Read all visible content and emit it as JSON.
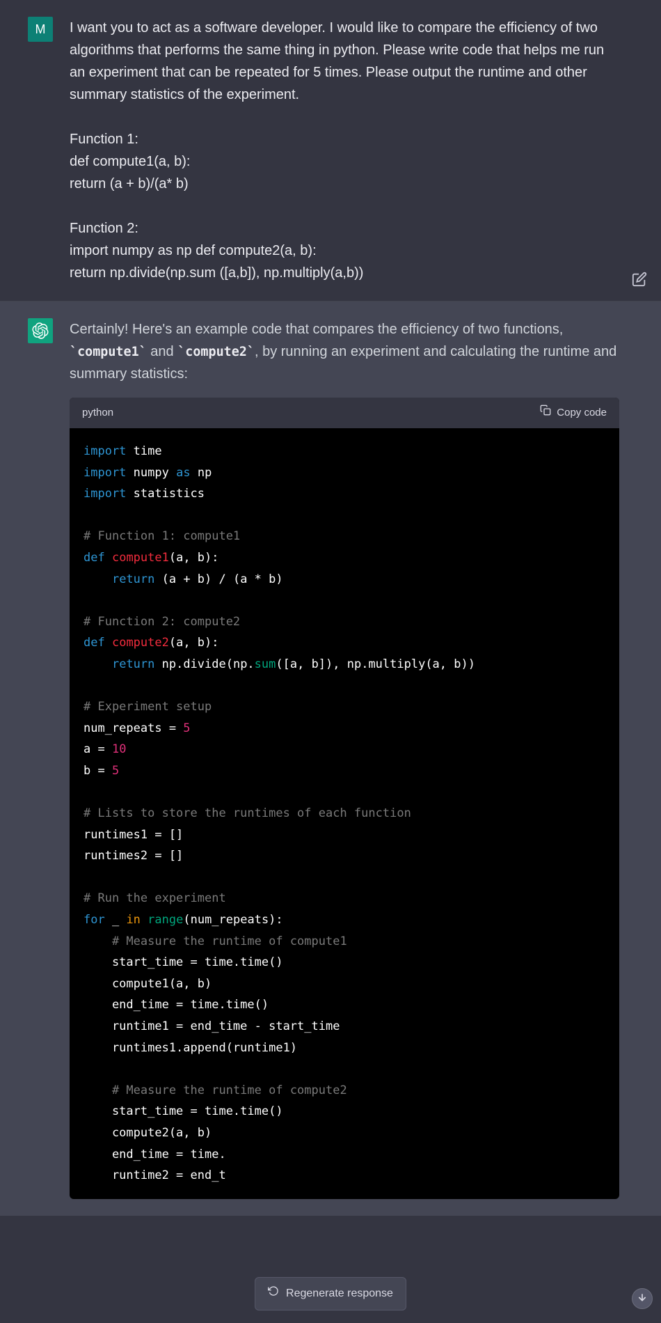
{
  "user": {
    "avatar_letter": "M",
    "message": "I want you to act as a software developer. I would like to compare the efficiency of two algorithms that performs the same thing in python. Please write code that helps me run an experiment that can be repeated for 5 times. Please output the runtime and other summary statistics of the experiment.\n\nFunction 1:\ndef compute1(a, b):\nreturn (a + b)/(a* b)\n\nFunction 2:\nimport numpy as np def compute2(a, b):\nreturn np.divide(np.sum ([a,b]), np.multiply(a,b))"
  },
  "assistant": {
    "intro_pre": "Certainly! Here's an example code that compares the efficiency of two functions, ",
    "code1": "`compute1`",
    "intro_mid": " and ",
    "code2": "`compute2`",
    "intro_post": ", by running an experiment and calculating the runtime and summary statistics:"
  },
  "codeblock": {
    "language": "python",
    "copy_label": "Copy code",
    "lines": [
      [
        [
          "kw",
          "import"
        ],
        [
          "pl",
          " "
        ],
        [
          "mod",
          "time"
        ]
      ],
      [
        [
          "kw",
          "import"
        ],
        [
          "pl",
          " "
        ],
        [
          "mod",
          "numpy"
        ],
        [
          "pl",
          " "
        ],
        [
          "kw",
          "as"
        ],
        [
          "pl",
          " "
        ],
        [
          "mod",
          "np"
        ]
      ],
      [
        [
          "kw",
          "import"
        ],
        [
          "pl",
          " "
        ],
        [
          "mod",
          "statistics"
        ]
      ],
      [],
      [
        [
          "cmt",
          "# Function 1: compute1"
        ]
      ],
      [
        [
          "def",
          "def"
        ],
        [
          "pl",
          " "
        ],
        [
          "fn",
          "compute1"
        ],
        [
          "pl",
          "(a, b):"
        ]
      ],
      [
        [
          "pl",
          "    "
        ],
        [
          "ret",
          "return"
        ],
        [
          "pl",
          " (a + b) / (a * b)"
        ]
      ],
      [],
      [
        [
          "cmt",
          "# Function 2: compute2"
        ]
      ],
      [
        [
          "def",
          "def"
        ],
        [
          "pl",
          " "
        ],
        [
          "fn",
          "compute2"
        ],
        [
          "pl",
          "(a, b):"
        ]
      ],
      [
        [
          "pl",
          "    "
        ],
        [
          "ret",
          "return"
        ],
        [
          "pl",
          " np.divide(np."
        ],
        [
          "call",
          "sum"
        ],
        [
          "pl",
          "([a, b]), np.multiply(a, b))"
        ]
      ],
      [],
      [
        [
          "cmt",
          "# Experiment setup"
        ]
      ],
      [
        [
          "pl",
          "num_repeats = "
        ],
        [
          "num",
          "5"
        ]
      ],
      [
        [
          "pl",
          "a = "
        ],
        [
          "num",
          "10"
        ]
      ],
      [
        [
          "pl",
          "b = "
        ],
        [
          "num",
          "5"
        ]
      ],
      [],
      [
        [
          "cmt",
          "# Lists to store the runtimes of each function"
        ]
      ],
      [
        [
          "pl",
          "runtimes1 = []"
        ]
      ],
      [
        [
          "pl",
          "runtimes2 = []"
        ]
      ],
      [],
      [
        [
          "cmt",
          "# Run the experiment"
        ]
      ],
      [
        [
          "kw",
          "for"
        ],
        [
          "pl",
          " _ "
        ],
        [
          "in",
          "in"
        ],
        [
          "pl",
          " "
        ],
        [
          "call",
          "range"
        ],
        [
          "pl",
          "(num_repeats):"
        ]
      ],
      [
        [
          "pl",
          "    "
        ],
        [
          "cmt",
          "# Measure the runtime of compute1"
        ]
      ],
      [
        [
          "pl",
          "    start_time = time.time()"
        ]
      ],
      [
        [
          "pl",
          "    compute1(a, b)"
        ]
      ],
      [
        [
          "pl",
          "    end_time = time.time()"
        ]
      ],
      [
        [
          "pl",
          "    runtime1 = end_time - start_time"
        ]
      ],
      [
        [
          "pl",
          "    runtimes1.append(runtime1)"
        ]
      ],
      [],
      [
        [
          "pl",
          "    "
        ],
        [
          "cmt",
          "# Measure the runtime of compute2"
        ]
      ],
      [
        [
          "pl",
          "    start_time = time.time()"
        ]
      ],
      [
        [
          "pl",
          "    compute2(a, b)"
        ]
      ],
      [
        [
          "pl",
          "    end_time = time."
        ]
      ],
      [
        [
          "pl",
          "    runtime2 = end_t"
        ]
      ]
    ]
  },
  "buttons": {
    "regenerate": "Regenerate response"
  }
}
